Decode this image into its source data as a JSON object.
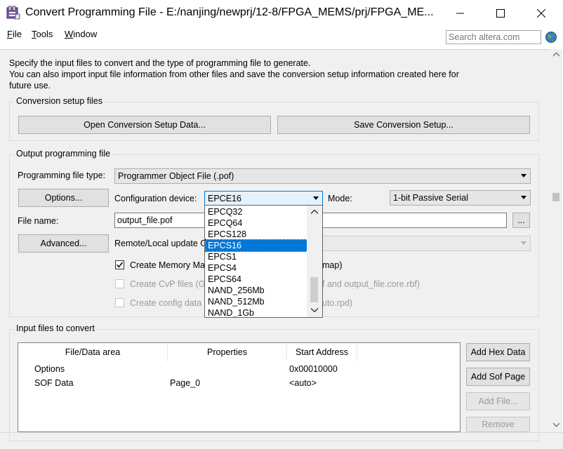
{
  "window": {
    "title": "Convert Programming File - E:/nanjing/newprj/12-8/FPGA_MEMS/prj/FPGA_ME..."
  },
  "icons": {
    "app": "convert-file-icon",
    "minimize": "minimize-icon",
    "maximize": "maximize-icon",
    "close": "close-icon",
    "globe": "globe-icon",
    "dropdown_arrow": "chevron-down-icon"
  },
  "menu": {
    "items": [
      {
        "label": "File",
        "accel": "F",
        "rest": "ile"
      },
      {
        "label": "Tools",
        "accel": "T",
        "rest": "ools"
      },
      {
        "label": "Window",
        "accel": "W",
        "rest": "indow"
      }
    ],
    "search_placeholder": "Search altera.com"
  },
  "intro": {
    "line1": "Specify the input files to convert and the type of programming file to generate.",
    "line2": "You can also import input file information from other files and save the conversion setup information created here for",
    "line3": "future use."
  },
  "conversion_setup": {
    "title": "Conversion setup files",
    "open_button": "Open Conversion Setup Data...",
    "save_button": "Save Conversion Setup..."
  },
  "output": {
    "title": "Output programming file",
    "programming_type_label": "Programming file type:",
    "programming_type_value": "Programmer Object File (.pof)",
    "options_button": "Options...",
    "config_device_label": "Configuration device:",
    "config_device_value": "EPCE16",
    "mode_label": "Mode:",
    "mode_value": "1-bit Passive Serial",
    "file_name_label": "File name:",
    "file_name_value": "output_file.pof",
    "browse_button": "...",
    "advanced_button": "Advanced...",
    "remote_local_label": "Remote/Local update G",
    "create_memory_map_label": "Create Memory Ma",
    "create_memory_map_tail": "map)",
    "create_memory_map_checked": true,
    "create_cvp_label": "Create CvP files (G",
    "create_cvp_tail": "f and output_file.core.rbf)",
    "create_config_label": "Create config data",
    "create_config_tail": "uto.rpd)"
  },
  "config_dropdown": {
    "options": [
      "EPCQ32",
      "EPCQ64",
      "EPCS128",
      "EPCS16",
      "EPCS1",
      "EPCS4",
      "EPCS64",
      "NAND_256Mb",
      "NAND_512Mb",
      "NAND_1Gb"
    ],
    "highlighted": "EPCS16"
  },
  "input_files": {
    "title": "Input files to convert",
    "columns": [
      "File/Data area",
      "Properties",
      "Start Address"
    ],
    "rows": [
      {
        "area": "Options",
        "properties": "",
        "address": "0x00010000"
      },
      {
        "area": "SOF Data",
        "properties": "Page_0",
        "address": "<auto>"
      }
    ],
    "buttons": {
      "add_hex": "Add Hex Data",
      "add_sof": "Add Sof Page",
      "add_file": "Add File...",
      "remove": "Remove"
    }
  }
}
